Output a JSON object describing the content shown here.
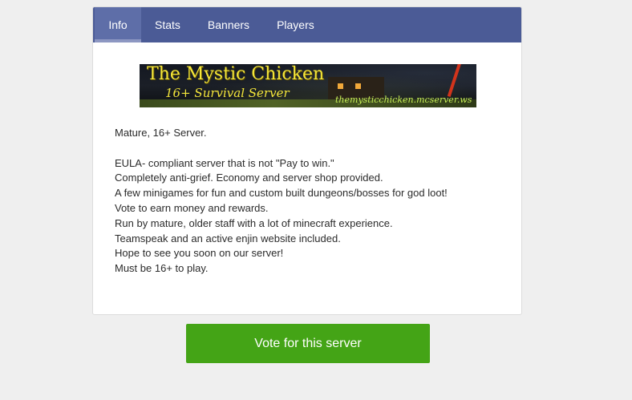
{
  "tabs": {
    "info": "Info",
    "stats": "Stats",
    "banners": "Banners",
    "players": "Players"
  },
  "banner": {
    "title": "The Mystic Chicken",
    "subtitle": "16+ Survival Server",
    "url": "themysticchicken.mcserver.ws"
  },
  "description": {
    "intro": "Mature, 16+ Server.",
    "lines": [
      "EULA- compliant server that is not \"Pay to win.\"",
      "Completely anti-grief. Economy and server shop provided.",
      "A few minigames for fun and custom built dungeons/bosses for god loot!",
      "Vote to earn money and rewards.",
      "Run by mature, older staff with a lot of minecraft experience.",
      "Teamspeak and an active enjin website included.",
      "Hope to see you soon on our server!",
      "Must be 16+ to play."
    ]
  },
  "vote_button": "Vote for this server",
  "colors": {
    "tab_bar": "#4b5b96",
    "tab_active": "#5e6ea8",
    "vote_button": "#44a416"
  }
}
